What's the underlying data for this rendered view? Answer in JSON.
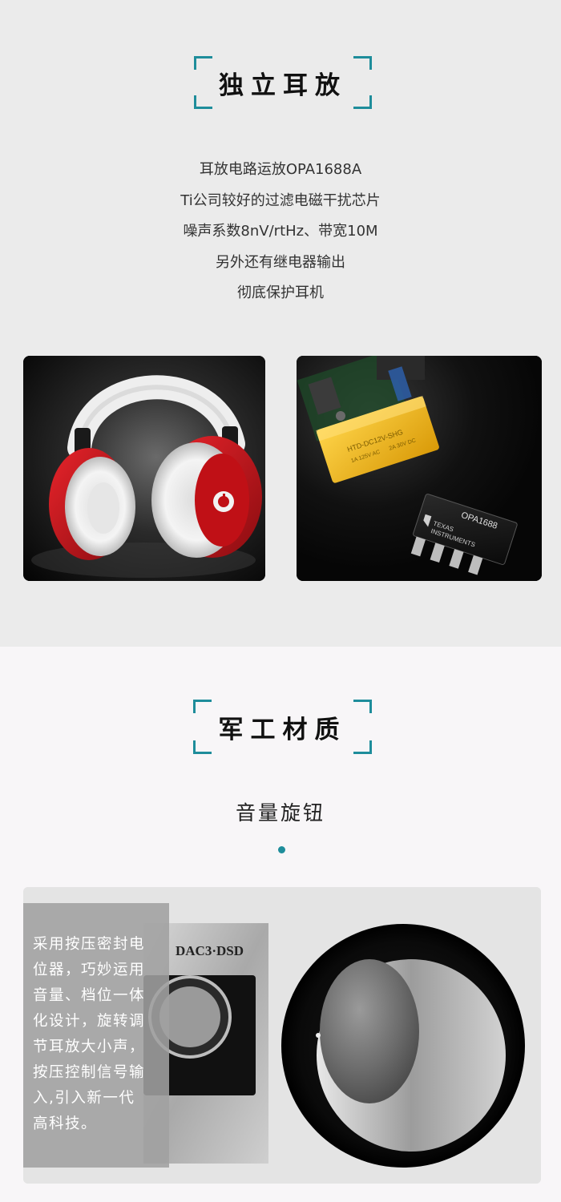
{
  "section1": {
    "title": "独立耳放",
    "lines": [
      "耳放电路运放OPA1688A",
      "Ti公司较好的过滤电磁干扰芯片",
      "噪声系数8nV/rtHz、带宽10M",
      "另外还有继电器输出",
      "彻底保护耳机"
    ],
    "chip_label": "OPA1688",
    "chip_brand_line1": "TEXAS",
    "chip_brand_line2": "INSTRUMENTS",
    "relay_label": "HTD-DC12V-SHG",
    "relay_small1": "1A 125V AC",
    "relay_small2": "2A 30V DC"
  },
  "section2": {
    "title": "军工材质",
    "subtitle": "音量旋钮",
    "device_label": "DAC3·DSD",
    "overlay_lines": [
      "采用按压密封电",
      "位器，巧妙运用",
      "音量、档位一体",
      "化设计，旋转调",
      "节耳放大小声，",
      "按压控制信号输",
      "入,引入新一代",
      "高科技。"
    ]
  },
  "colors": {
    "accent": "#1e8d9b",
    "headphone_red": "#c8141b"
  }
}
